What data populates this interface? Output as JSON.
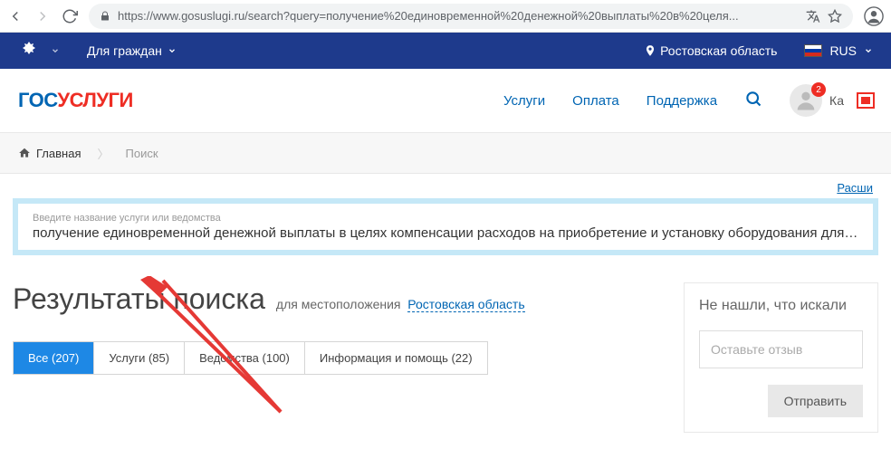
{
  "browser": {
    "url": "https://www.gosuslugi.ru/search?query=получение%20единовременной%20денежной%20выплаты%20в%20целя..."
  },
  "topbar": {
    "citizens": "Для граждан",
    "region": "Ростовская область",
    "lang": "RUS"
  },
  "header": {
    "logo_part1": "гос",
    "logo_part2": "услуги",
    "nav": {
      "services": "Услуги",
      "payment": "Оплата",
      "support": "Поддержка"
    },
    "badge": "2",
    "user": "Ка"
  },
  "breadcrumbs": {
    "home": "Главная",
    "search": "Поиск"
  },
  "expand": "Расши",
  "search": {
    "label": "Введите название услуги или ведомства",
    "value": "получение единовременной денежной выплаты в целях компенсации расходов на приобретение и установку оборудования для ..."
  },
  "results": {
    "title": "Результаты поиска",
    "sub": "для местоположения",
    "location": "Ростовская область",
    "tabs": {
      "all": "Все (207)",
      "services": "Услуги (85)",
      "agencies": "Ведомства (100)",
      "info": "Информация и помощь (22)"
    }
  },
  "feedback": {
    "title": "Не нашли, что искали",
    "placeholder": "Оставьте отзыв",
    "submit": "Отправить"
  }
}
